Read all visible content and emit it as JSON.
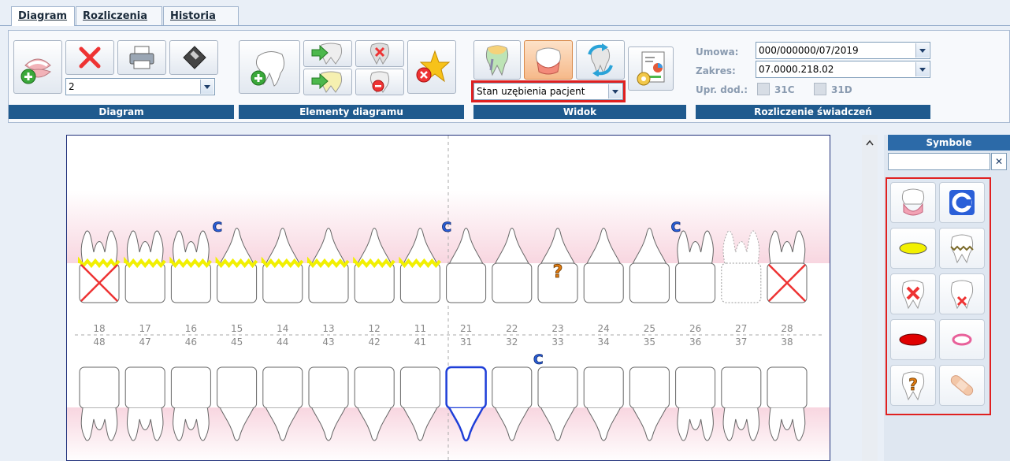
{
  "tabs": [
    {
      "label": "Diagram",
      "active": true
    },
    {
      "label": "Rozliczenia"
    },
    {
      "label": "Historia"
    }
  ],
  "toolbar": {
    "diagram_group": "Diagram",
    "diagram_select": "2",
    "elements_group": "Elementy diagramu",
    "view_group": "Widok",
    "view_select": "Stan uzębienia pacjent",
    "settlement_group": "Rozliczenie świadczeń",
    "umowa_label": "Umowa:",
    "umowa_value": "000/000000/07/2019",
    "zakres_label": "Zakres:",
    "zakres_value": "07.0000.218.02",
    "upr_label": "Upr. dod.:",
    "chk1": "31C",
    "chk2": "31D"
  },
  "teeth": {
    "upper_numbers": [
      "18",
      "17",
      "16",
      "15",
      "14",
      "13",
      "12",
      "11",
      "21",
      "22",
      "23",
      "24",
      "25",
      "26",
      "27",
      "28"
    ],
    "lower_numbers": [
      "48",
      "47",
      "46",
      "45",
      "44",
      "43",
      "42",
      "41",
      "31",
      "32",
      "33",
      "34",
      "35",
      "36",
      "37",
      "38"
    ],
    "marker_c": "C",
    "marker_q": "?"
  },
  "sidebar": {
    "title": "Symbole",
    "search_value": "",
    "clear": "✕"
  },
  "colors": {
    "accent_blue": "#1f5a8e",
    "highlight_red": "#e02020",
    "gum_pink": "#f8d6e0",
    "filling_yellow": "#f2f000"
  }
}
